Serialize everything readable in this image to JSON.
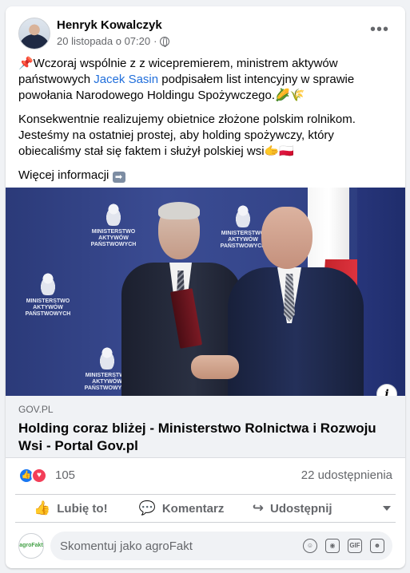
{
  "post": {
    "author": "Henryk Kowalczyk",
    "date": "20 listopada o 07:20",
    "date_separator": "·",
    "menu": "•••",
    "paragraph1_prefix": "📌Wczoraj wspólnie z  z wicepremierem, ministrem aktywów państwowych ",
    "mention": "Jacek Sasin",
    "paragraph1_suffix": " podpisałem list intencyjny w sprawie powołania Narodowego Holdingu Spożywczego.🌽🌾",
    "paragraph2": "Konsekwentnie realizujemy obietnice złożone polskim rolnikom. Jesteśmy na ostatniej prostej, aby holding spożywczy, który obiecaliśmy stał się faktem i służył polskiej wsi🫱🇵🇱",
    "more_info": "Więcej informacji"
  },
  "photo": {
    "ministry_lines": [
      "MINISTERSTWO",
      "AKTYWÓW",
      "PAŃSTWOWYCH"
    ],
    "info_glyph": "i"
  },
  "link_preview": {
    "domain": "GOV.PL",
    "title": "Holding coraz bliżej - Ministerstwo Rolnictwa i Rozwoju Wsi - Portal Gov.pl"
  },
  "stats": {
    "reactions_count": "105",
    "shares": "22 udostępnienia"
  },
  "actions": {
    "like": "Lubię to!",
    "comment": "Komentarz",
    "share": "Udostępnij"
  },
  "comment": {
    "placeholder": "Skomentuj jako agroFakt",
    "avatar_text": "agroFakt",
    "icons": [
      "emoji-icon",
      "camera-icon",
      "gif-icon",
      "sticker-icon"
    ]
  }
}
